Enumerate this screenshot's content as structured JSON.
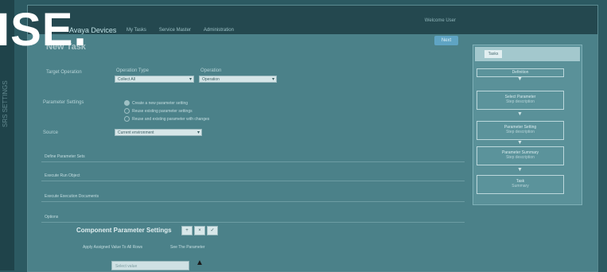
{
  "overlay": {
    "big_text": "ISE."
  },
  "bezel": {
    "side_text": "SRS SETTINGS"
  },
  "app": {
    "brand": "Avaya Devices",
    "nav": [
      "My Tasks",
      "Service Master",
      "Administration"
    ],
    "user": "Welcome User"
  },
  "page": {
    "title": "New Task",
    "next_button": "Next"
  },
  "form": {
    "target_operation": {
      "label": "Target Operation"
    },
    "operation_type": {
      "label": "Operation Type",
      "value": "Collect All"
    },
    "operation": {
      "label": "Operation",
      "value": "Operation"
    },
    "parameter_settings": {
      "label": "Parameter Settings",
      "options": [
        {
          "label": "Create a new parameter setting",
          "selected": true
        },
        {
          "label": "Reuse existing parameter settings",
          "selected": false
        },
        {
          "label": "Reuse and existing parameter with changes",
          "selected": false
        }
      ]
    },
    "source": {
      "label": "Source",
      "value": "Current environment"
    }
  },
  "sections": [
    "Define Parameter Sets",
    "Execute Run Object",
    "Execute Execution Documents",
    "Options"
  ],
  "component": {
    "title": "Component Parameter Settings",
    "tools": [
      "+",
      "×",
      "✓"
    ],
    "apply_label": "Apply Assigned Value To All Rows",
    "see_label": "See The Parameter",
    "input_placeholder": "Select value"
  },
  "workflow": {
    "header": "Tasks",
    "steps": [
      {
        "title": "Definition",
        "sub": ""
      },
      {
        "title": "Select Parameter",
        "sub": "Step description"
      },
      {
        "title": "Parameter Setting",
        "sub": "Step description"
      },
      {
        "title": "Parameter Summary",
        "sub": "Step description"
      },
      {
        "title": "Task",
        "sub": "Summary"
      }
    ]
  }
}
